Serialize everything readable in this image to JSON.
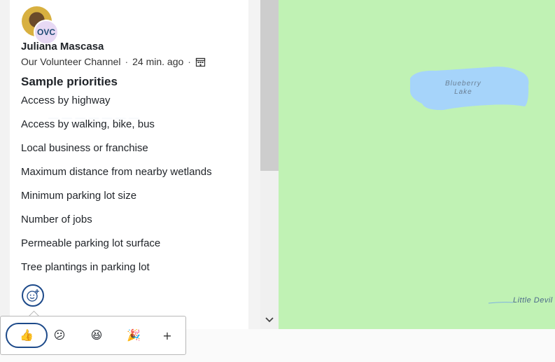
{
  "post": {
    "author": "Juliana Mascasa",
    "org_initials": "OVC",
    "channel": "Our Volunteer Channel",
    "separator": "·",
    "time_ago": "24 min. ago",
    "title": "Sample priorities",
    "priorities": [
      "Access by highway",
      "Access by walking, bike, bus",
      "Local business or franchise",
      "Maximum distance from nearby wetlands",
      "Minimum parking lot size",
      "Number of jobs",
      "Permeable parking lot surface",
      "Tree plantings in parking lot"
    ]
  },
  "map": {
    "lake_name_line1": "Blueberry",
    "lake_name_line2": "Lake",
    "place_label": "Little Devil",
    "land_color": "#c0f2b4",
    "water_color": "#a6d4fa"
  },
  "reactions": {
    "items": [
      {
        "icon": "thumbs-up-icon",
        "glyph": "👍",
        "selected": true
      },
      {
        "icon": "confused-face-icon",
        "glyph": "😕",
        "selected": false
      },
      {
        "icon": "grinning-squint-face-icon",
        "glyph": "😆",
        "selected": false
      },
      {
        "icon": "party-popper-icon",
        "glyph": "🎉",
        "selected": false
      }
    ],
    "add_label": "+"
  },
  "colors": {
    "accent": "#1d4a8a",
    "badge_bg": "#e7d9f4"
  }
}
